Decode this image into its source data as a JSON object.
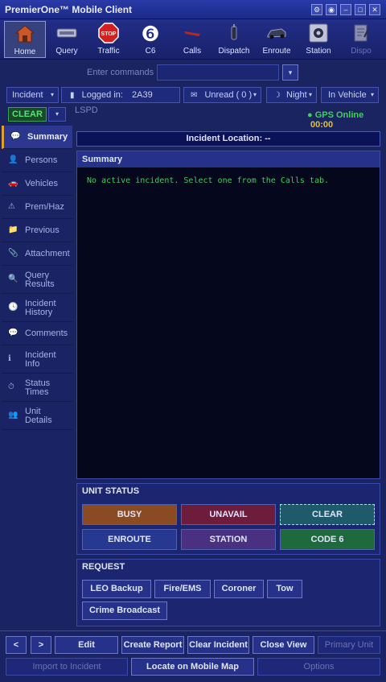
{
  "window": {
    "title": "PremierOne™ Mobile Client",
    "controls": [
      "gear",
      "settings",
      "minimize",
      "maximize",
      "close"
    ]
  },
  "toolbar": {
    "items": [
      {
        "label": "Home",
        "icon": "home-icon",
        "active": true,
        "disabled": false
      },
      {
        "label": "Query",
        "icon": "query-icon",
        "active": false,
        "disabled": false
      },
      {
        "label": "Traffic",
        "icon": "stop-sign-icon",
        "active": false,
        "disabled": false
      },
      {
        "label": "C6",
        "icon": "code6-icon",
        "active": false,
        "disabled": false
      },
      {
        "label": "Calls",
        "icon": "calls-icon",
        "active": false,
        "disabled": false
      },
      {
        "label": "Dispatch",
        "icon": "dispatch-icon",
        "active": false,
        "disabled": false
      },
      {
        "label": "Enroute",
        "icon": "car-icon",
        "active": false,
        "disabled": false
      },
      {
        "label": "Station",
        "icon": "station-icon",
        "active": false,
        "disabled": false
      },
      {
        "label": "Dispo",
        "icon": "dispo-icon",
        "active": false,
        "disabled": true
      }
    ],
    "c6_glyph": "❻",
    "stop_glyph": "STOP"
  },
  "command": {
    "label": "Enter commands",
    "value": "",
    "dropdown_glyph": "▾"
  },
  "status": {
    "incident": "Incident",
    "logged_in_label": "Logged in:",
    "unit_id": "2A39",
    "agency": "LSPD",
    "unread": "Unread ( 0 )",
    "mode": "Night",
    "location": "In Vehicle",
    "arrow": "▾",
    "clear_badge": "CLEAR",
    "gps": "● GPS Online",
    "gps_time": "00:00"
  },
  "sidebar": {
    "items": [
      {
        "label": "Summary",
        "icon": "💬",
        "active": true
      },
      {
        "label": "Persons",
        "icon": "👤",
        "active": false
      },
      {
        "label": "Vehicles",
        "icon": "🚗",
        "active": false
      },
      {
        "label": "Prem/Haz",
        "icon": "⚠",
        "active": false
      },
      {
        "label": "Previous",
        "icon": "📁",
        "active": false
      },
      {
        "label": "Attachment",
        "icon": "📎",
        "active": false
      },
      {
        "label": "Query Results",
        "icon": "🔍",
        "active": false
      },
      {
        "label": "Incident History",
        "icon": "🕓",
        "active": false
      },
      {
        "label": "Comments",
        "icon": "💬",
        "active": false
      },
      {
        "label": "Incident Info",
        "icon": "ℹ",
        "active": false
      },
      {
        "label": "Status Times",
        "icon": "⏱",
        "active": false
      },
      {
        "label": "Unit Details",
        "icon": "👥",
        "active": false
      }
    ]
  },
  "incident": {
    "header": "Incident Location: --",
    "summary_title": "Summary",
    "summary_text": "No active incident. Select one from the Calls tab."
  },
  "unit_status": {
    "title": "UNIT STATUS",
    "buttons": [
      {
        "label": "BUSY",
        "color": "#8a4a22"
      },
      {
        "label": "UNAVAIL",
        "color": "#6e1c3c"
      },
      {
        "label": "CLEAR",
        "color": "#1e5a6a"
      },
      {
        "label": "ENROUTE",
        "color": "#263890"
      },
      {
        "label": "STATION",
        "color": "#4a3080"
      },
      {
        "label": "CODE 6",
        "color": "#1e6a3c"
      }
    ]
  },
  "request": {
    "title": "REQUEST",
    "buttons": [
      "LEO Backup",
      "Fire/EMS",
      "Coroner",
      "Tow",
      "Crime Broadcast"
    ]
  },
  "bottom": {
    "prev": "<",
    "next": ">",
    "edit": "Edit",
    "create_report": "Create Report",
    "clear_incident": "Clear Incident",
    "close_view": "Close View",
    "primary_unit": "Primary Unit",
    "import": "Import to Incident",
    "locate": "Locate on Mobile Map",
    "options": "Options"
  }
}
